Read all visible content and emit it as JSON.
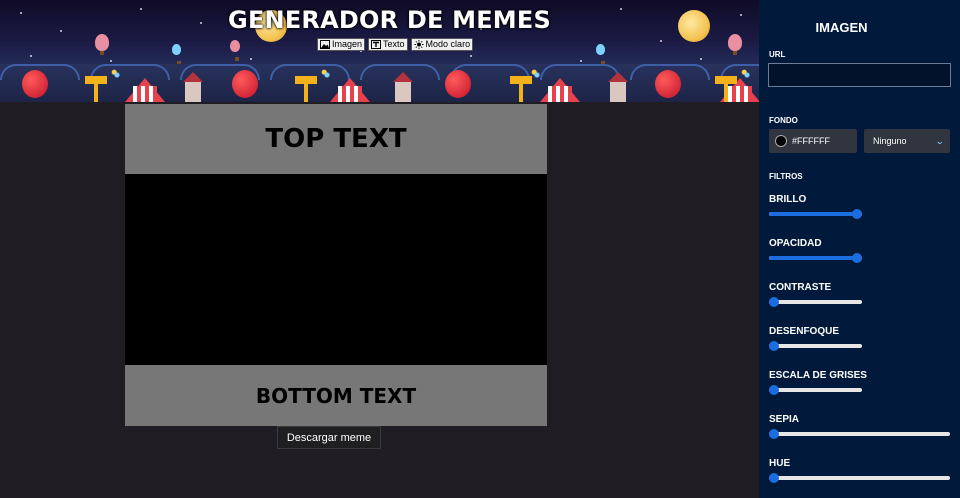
{
  "header": {
    "title": "GENERADOR DE MEMES",
    "nav": [
      {
        "label": "Imagen",
        "icon": "image-icon"
      },
      {
        "label": "Texto",
        "icon": "text-icon"
      },
      {
        "label": "Modo claro",
        "icon": "sun-icon"
      }
    ]
  },
  "meme": {
    "top_text": "TOP TEXT",
    "bottom_text": "BOTTOM TEXT",
    "download_label": "Descargar meme"
  },
  "panel": {
    "title": "IMAGEN",
    "url_label": "URL",
    "url_value": "",
    "fondo_label": "FONDO",
    "color_value": "#FFFFFF",
    "blend_value": "Ninguno",
    "filtros_label": "FILTROS",
    "filters": [
      {
        "label": "BRILLO",
        "value": 1.0
      },
      {
        "label": "OPACIDAD",
        "value": 1.0
      },
      {
        "label": "CONTRASTE",
        "value": 0.0
      },
      {
        "label": "DESENFOQUE",
        "value": 0.0
      },
      {
        "label": "ESCALA DE GRISES",
        "value": 0.0
      },
      {
        "label": "SEPIA",
        "value": 0.0
      },
      {
        "label": "HUE",
        "value": 0.0
      }
    ]
  },
  "colors": {
    "accent": "#1a6ee0",
    "panel_bg": "#011a3c",
    "page_bg": "#1f1d23",
    "meme_text_bg": "#777777"
  }
}
